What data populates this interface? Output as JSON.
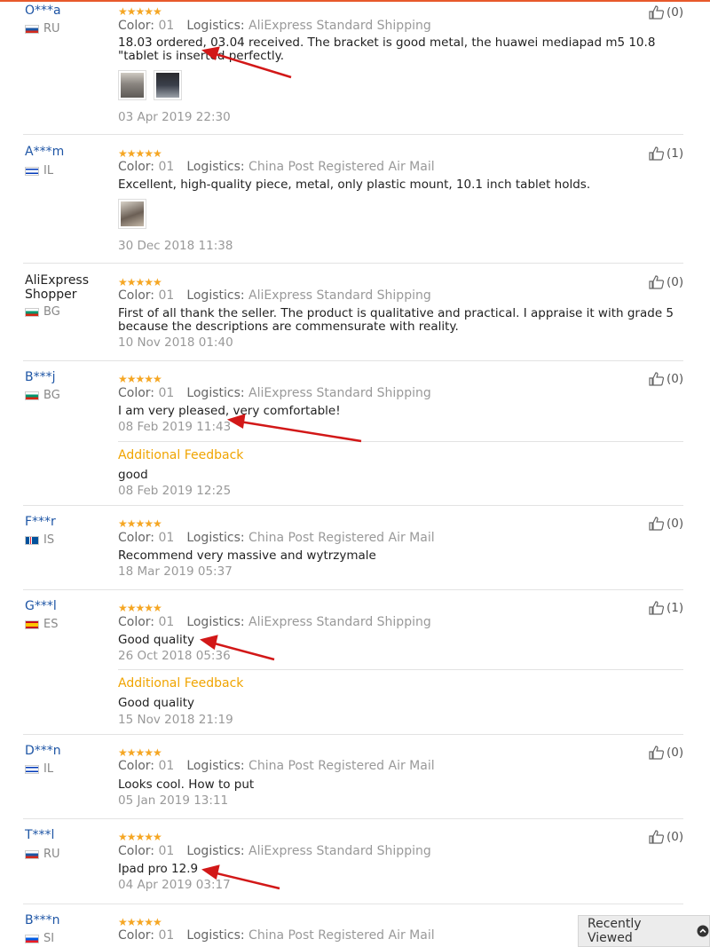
{
  "colors": {
    "accent": "#e8592b",
    "username": "#1e55a5",
    "stars": "#f5a623",
    "additional_feedback": "#f0a400",
    "annotation_arrow": "#d21818"
  },
  "labels": {
    "color": "Color:",
    "logistics": "Logistics:",
    "additional_feedback": "Additional Feedback"
  },
  "rating": "★★★★★",
  "reviews": [
    {
      "user": "O***a",
      "country": "RU",
      "flag": "ru",
      "color": "01",
      "logistics": "AliExpress Standard Shipping",
      "text": "18.03 ordered, 03.04 received. The bracket is good metal, the huawei mediapad m5 10.8 \"tablet is inserted perfectly.",
      "date": "03 Apr 2019 22:30",
      "likes": "(0)"
    },
    {
      "user": "A***m",
      "country": "IL",
      "flag": "il",
      "color": "01",
      "logistics": "China Post Registered Air Mail",
      "text": "Excellent, high-quality piece, metal, only plastic mount, 10.1 inch tablet holds.",
      "date": "30 Dec 2018 11:38",
      "likes": "(1)"
    },
    {
      "user": "AliExpress Shopper",
      "country": "BG",
      "flag": "bg",
      "color": "01",
      "logistics": "AliExpress Standard Shipping",
      "text": "First of all thank the seller. The product is qualitative and practical. I appraise it with grade 5 because the descriptions are commensurate with reality.",
      "date": "10 Nov 2018 01:40",
      "likes": "(0)"
    },
    {
      "user": "B***j",
      "country": "BG",
      "flag": "bg",
      "color": "01",
      "logistics": "AliExpress Standard Shipping",
      "text": "I am very pleased, very comfortable!",
      "date": "08 Feb 2019 11:43",
      "likes": "(0)",
      "additional_text": "good",
      "additional_date": "08 Feb 2019 12:25"
    },
    {
      "user": "F***r",
      "country": "IS",
      "flag": "is",
      "color": "01",
      "logistics": "China Post Registered Air Mail",
      "text": "Recommend very massive and wytrzymale",
      "date": "18 Mar 2019 05:37",
      "likes": "(0)"
    },
    {
      "user": "G***l",
      "country": "ES",
      "flag": "es",
      "color": "01",
      "logistics": "AliExpress Standard Shipping",
      "text": "Good quality",
      "date": "26 Oct 2018 05:36",
      "likes": "(1)",
      "additional_text": "Good quality",
      "additional_date": "15 Nov 2018 21:19"
    },
    {
      "user": "D***n",
      "country": "IL",
      "flag": "il",
      "color": "01",
      "logistics": "China Post Registered Air Mail",
      "text": "Looks cool. How to put",
      "date": "05 Jan 2019 13:11",
      "likes": "(0)"
    },
    {
      "user": "T***l",
      "country": "RU",
      "flag": "ru",
      "color": "01",
      "logistics": "AliExpress Standard Shipping",
      "text": "Ipad pro 12.9",
      "date": "04 Apr 2019 03:17",
      "likes": "(0)"
    },
    {
      "user": "B***n",
      "country": "SI",
      "flag": "si",
      "color": "01",
      "logistics": "China Post Registered Air Mail"
    }
  ],
  "recently_viewed": "Recently Viewed"
}
